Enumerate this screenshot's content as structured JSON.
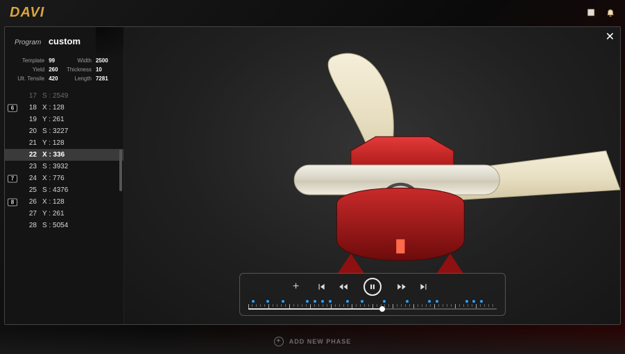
{
  "topbar": {
    "logo": "DAVI"
  },
  "bottombar": {
    "add_phase_label": "ADD NEW PHASE"
  },
  "modal": {
    "close": "✕",
    "program_label": "Program",
    "program_name": "custom",
    "meta": {
      "template_label": "Template",
      "template_value": "99",
      "width_label": "Width",
      "width_value": "2500",
      "yield_label": "Yield",
      "yield_value": "260",
      "thickness_label": "Thickness",
      "thickness_value": "10",
      "ult_tensile_label": "Ult. Tensile",
      "ult_tensile_value": "420",
      "length_label": "Length",
      "length_value": "7281"
    },
    "steps": [
      {
        "idx": "17",
        "val": "S : 2549",
        "badge": "",
        "sel": false,
        "dim": true
      },
      {
        "idx": "18",
        "val": "X : 128",
        "badge": "6",
        "sel": false,
        "dim": false
      },
      {
        "idx": "19",
        "val": "Y : 261",
        "badge": "",
        "sel": false,
        "dim": false
      },
      {
        "idx": "20",
        "val": "S : 3227",
        "badge": "",
        "sel": false,
        "dim": false
      },
      {
        "idx": "21",
        "val": "Y : 128",
        "badge": "",
        "sel": false,
        "dim": false
      },
      {
        "idx": "22",
        "val": "X : 336",
        "badge": "",
        "sel": true,
        "dim": false
      },
      {
        "idx": "23",
        "val": "S : 3932",
        "badge": "",
        "sel": false,
        "dim": false
      },
      {
        "idx": "24",
        "val": "X : 776",
        "badge": "7",
        "sel": false,
        "dim": false
      },
      {
        "idx": "25",
        "val": "S : 4376",
        "badge": "",
        "sel": false,
        "dim": false
      },
      {
        "idx": "26",
        "val": "X : 128",
        "badge": "8",
        "sel": false,
        "dim": false
      },
      {
        "idx": "27",
        "val": "Y : 261",
        "badge": "",
        "sel": false,
        "dim": false
      },
      {
        "idx": "28",
        "val": "S : 5054",
        "badge": "",
        "sel": false,
        "dim": false
      },
      {
        "idx": "",
        "val": "",
        "badge": "",
        "sel": false,
        "dim": true
      }
    ],
    "player": {
      "zoom_in": "+",
      "progress_pct": 54,
      "marker_pcts": [
        2,
        8,
        14,
        24,
        27,
        30,
        33,
        40,
        46,
        55,
        64,
        73,
        76,
        88,
        91,
        94
      ]
    }
  }
}
